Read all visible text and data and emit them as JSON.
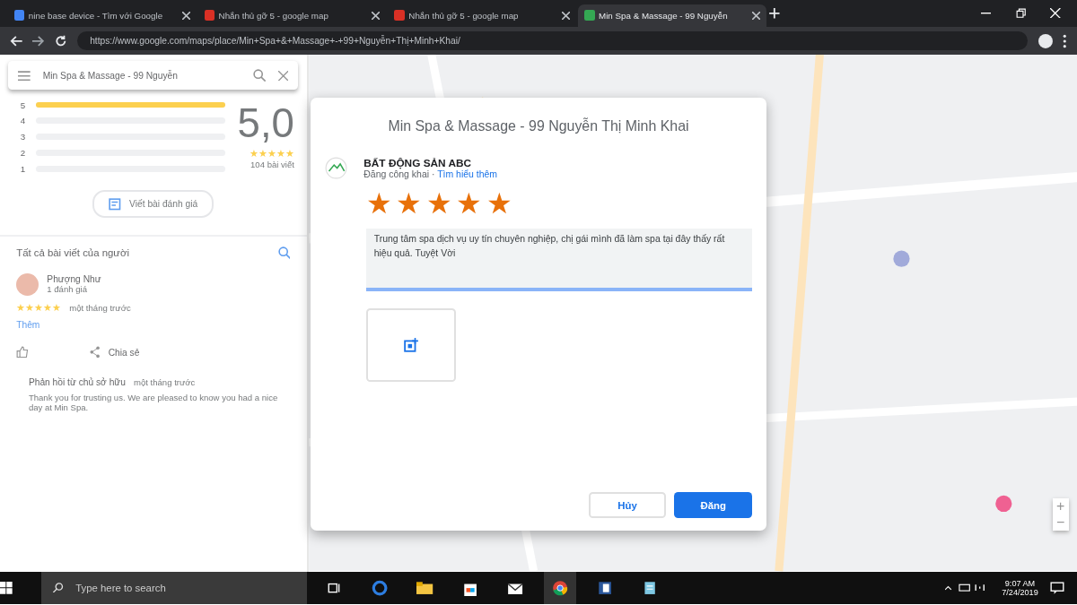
{
  "browser": {
    "tabs": [
      {
        "title": "nine base device - Tìm với Google",
        "selected": false,
        "color": "#4285f4"
      },
      {
        "title": "Nhắn thủ gỡ 5 - google map",
        "selected": false,
        "color": "#d93025"
      },
      {
        "title": "Nhắn thủ gỡ 5 - google map",
        "selected": false,
        "color": "#d93025"
      },
      {
        "title": "Min Spa & Massage - 99 Nguyễn",
        "selected": true,
        "color": "#34a853"
      }
    ],
    "url": "https://www.google.com/maps/place/Min+Spa+&+Massage+-+99+Nguyễn+Thị+Minh+Khai/"
  },
  "place_panel": {
    "search": "Min Spa & Massage - 99 Nguyễn",
    "rating_bars": [
      {
        "label": "5",
        "level": 1
      },
      {
        "label": "4",
        "level": 0
      },
      {
        "label": "3",
        "level": 0
      },
      {
        "label": "2",
        "level": 0
      },
      {
        "label": "1",
        "level": 0
      }
    ],
    "score": "5,0",
    "stars": 5,
    "review_count": "104 bài viết",
    "write_review": "Viết bài đánh giá",
    "reviews_heading": "Tất cả bài viết của người",
    "review": {
      "author": "Phượng Như",
      "meta": "1 đánh giá",
      "stars": 5,
      "time": "một tháng trước",
      "more": "Thêm",
      "share": "Chia sẻ"
    },
    "owner_reply": {
      "title": "Phản hồi từ chủ sở hữu",
      "time": "một tháng trước",
      "text": "Thank you for trusting us. We are pleased to know you had a nice day at Min Spa."
    }
  },
  "map": {
    "controls": [
      "+",
      "−"
    ]
  },
  "dialog": {
    "title": "Min Spa & Massage - 99 Nguyễn Thị Minh Khai",
    "author": "BẤT ĐỘNG SẢN ABC",
    "visibility": "Đăng công khai ·",
    "learn_more": "Tìm hiểu thêm",
    "stars": 5,
    "review_text": "Trung tâm spa dịch vụ uy tín chuyên nghiệp, chị gái mình đã làm spa tại đây thấy rất hiệu quả. Tuyệt Vời",
    "cancel": "Hủy",
    "post": "Đăng"
  },
  "taskbar": {
    "search_placeholder": "Type here to search",
    "time": "9:07 AM",
    "date": "7/24/2019"
  }
}
